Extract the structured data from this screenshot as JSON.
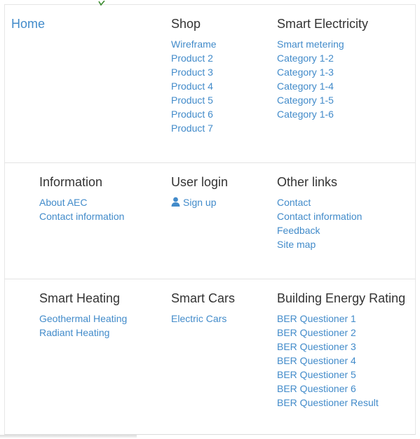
{
  "home": {
    "label": "Home"
  },
  "shop": {
    "title": "Shop",
    "items": [
      "Wireframe",
      "Product 2",
      "Product 3",
      "Product 4",
      "Product 5",
      "Product 6",
      "Product 7"
    ]
  },
  "smart_electricity": {
    "title": "Smart Electricity",
    "items": [
      "Smart metering",
      "Category 1-2",
      "Category 1-3",
      "Category 1-4",
      "Category 1-5",
      "Category 1-6"
    ]
  },
  "information": {
    "title": "Information",
    "items": [
      "About AEC",
      "Contact information"
    ]
  },
  "user_login": {
    "title": "User login",
    "sign_up": "Sign up",
    "icon": "user-icon"
  },
  "other_links": {
    "title": "Other links",
    "items": [
      "Contact",
      "Contact information",
      "Feedback",
      "Site map"
    ]
  },
  "smart_heating": {
    "title": "Smart Heating",
    "items": [
      "Geothermal Heating",
      "Radiant Heating"
    ]
  },
  "smart_cars": {
    "title": "Smart Cars",
    "items": [
      "Electric Cars"
    ]
  },
  "ber": {
    "title": "Building Energy Rating",
    "items": [
      "BER Questioner 1",
      "BER Questioner 2",
      "BER Questioner 3",
      "BER Questioner 4",
      "BER Questioner 5",
      "BER Questioner 6",
      "BER Questioner Result"
    ]
  },
  "colors": {
    "link": "#428bca",
    "heading": "#333333",
    "divider": "#e3e3e3"
  }
}
